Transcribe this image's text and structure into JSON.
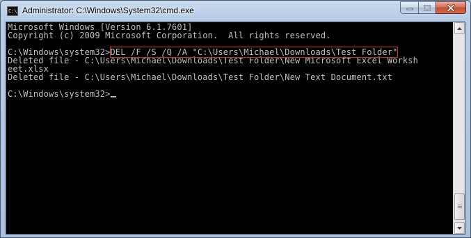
{
  "window": {
    "title": "Administrator: C:\\Windows\\System32\\cmd.exe",
    "icon": "cmd-icon",
    "icon_text": "C:\\"
  },
  "caption_buttons": [
    "minimize-icon",
    "maximize-icon",
    "close-icon"
  ],
  "console": {
    "lines": [
      "Microsoft Windows [Version 6.1.7601]",
      "Copyright (c) 2009 Microsoft Corporation.  All rights reserved.",
      "",
      "",
      "Deleted file - C:\\Users\\Michael\\Downloads\\Test Folder\\New Microsoft Excel Worksh",
      "eet.xlsx",
      "Deleted file - C:\\Users\\Michael\\Downloads\\Test Folder\\New Text Document.txt",
      "",
      "C:\\Windows\\system32>"
    ],
    "prompt": "C:\\Windows\\system32>",
    "command": "DEL /F /S /Q /A \"C:\\Users\\Michael\\Downloads\\Test Folder\"",
    "text_color": "#c0c0c0",
    "background_color": "#000000",
    "highlight_color": "#e0261b"
  },
  "scrollbar": {
    "up_icon": "scroll-up-arrow-icon",
    "down_icon": "scroll-down-arrow-icon",
    "position_fraction": 1.0
  }
}
